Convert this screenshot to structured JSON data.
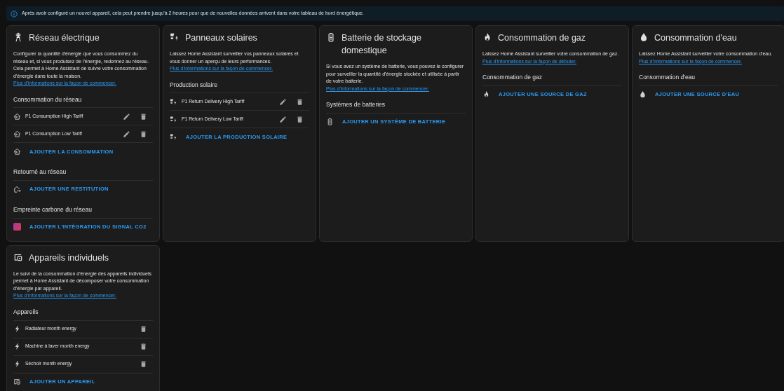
{
  "banner": {
    "text": "Après avoir configuré un nouvel appareil, cela peut prendre jusqu'à 2 heures pour que de nouvelles données arrivent dans votre tableau de bord énergétique."
  },
  "cards": [
    {
      "title": "Réseau électrique",
      "description": "Configurer la quantité d'énergie que vous consommez du réseau et, si vous produisez de l'énergie, redonnez au réseau. Cela permet à Home Assistant de suivre votre consommation d'énergie dans toute la maison.",
      "link": "Plus d'informations sur la façon de commencer.",
      "sections": [
        {
          "heading": "Consommation du réseau",
          "items": [
            {
              "label": "P1 Consumption High Tariff",
              "editable": true
            },
            {
              "label": "P1 Consumption Low Tariff",
              "editable": true
            }
          ],
          "add": "AJOUTER LA CONSOMMATION"
        },
        {
          "heading": "Retourné au réseau",
          "add": "AJOUTER UNE RESTITUTION"
        },
        {
          "heading": "Empreinte carbone du réseau",
          "add": "AJOUTER L'INTÉGRATION DU SIGNAL CO2"
        }
      ]
    },
    {
      "title": "Panneaux solaires",
      "description": "Laissez Home Assistant surveiller vos panneaux solaires et vous donner un aperçu de leurs performances.",
      "link": "Plus d'informations sur la façon de commencer.",
      "sections": [
        {
          "heading": "Production solaire",
          "items": [
            {
              "label": "P1 Return Delivery High Tariff",
              "editable": true
            },
            {
              "label": "P1 Return Delivery Low Tariff",
              "editable": true
            }
          ],
          "add": "AJOUTER LA PRODUCTION SOLAIRE"
        }
      ]
    },
    {
      "title": "Batterie de stockage domestique",
      "description": "Si vous avez un système de batterie, vous pouvez le configurer pour surveiller la quantité d'énergie stockée et utilisée à partir de votre batterie.",
      "link": "Plus d'informations sur la façon de commencer.",
      "sections": [
        {
          "heading": "Systèmes de batteries",
          "add": "AJOUTER UN SYSTÈME DE BATTERIE"
        }
      ]
    },
    {
      "title": "Consommation de gaz",
      "description": "Laissez Home Assistant surveiller votre consommation de gaz.",
      "link": "Plus d'informations sur la façon de débuter.",
      "sections": [
        {
          "heading": "Consommation de gaz",
          "add": "AJOUTER UNE SOURCE DE GAZ"
        }
      ]
    },
    {
      "title": "Consommation d'eau",
      "description": "Laissez Home Assistant surveiller votre consommation d'eau.",
      "link": "Plus d'informations sur la façon de commencer.",
      "sections": [
        {
          "heading": "Consommation d'eau",
          "add": "AJOUTER UNE SOURCE D'EAU"
        }
      ]
    },
    {
      "title": "Appareils individuels",
      "description": "Le suivi de la consommation d'énergie des appareils individuels permet à Home Assistant de décomposer votre consommation d'énergie par appareil.",
      "link": "Plus d'informations sur la façon de commencer.",
      "sections": [
        {
          "heading": "Appareils",
          "items": [
            {
              "label": "Radiateur month energy",
              "editable": false
            },
            {
              "label": "Machine à laver month energy",
              "editable": false
            },
            {
              "label": "Séchoir month energy",
              "editable": false
            }
          ],
          "add": "AJOUTER UN APPAREIL"
        }
      ]
    }
  ]
}
